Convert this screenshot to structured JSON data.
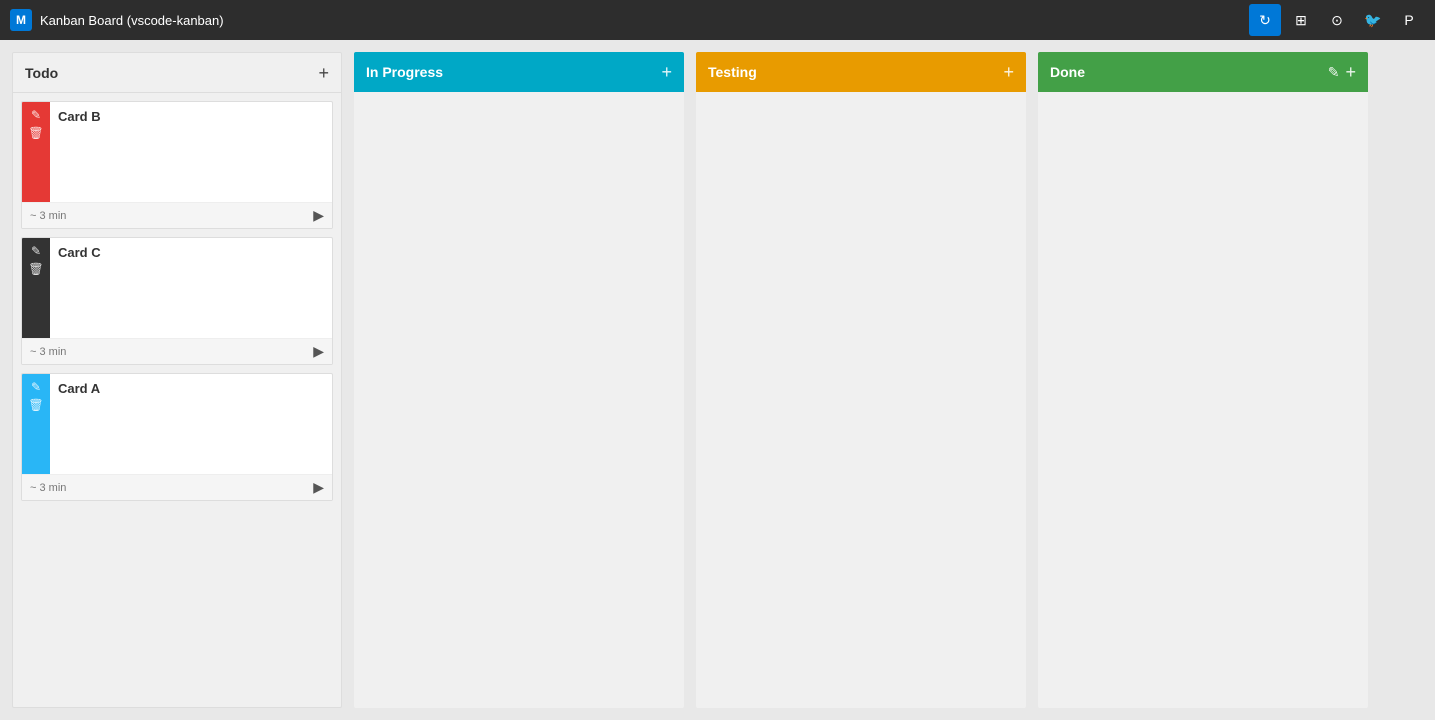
{
  "header": {
    "title": "Kanban Board (vscode-kanban)",
    "logo_text": "M",
    "icons": {
      "refresh": "↻",
      "file": "▦",
      "github": "⊙",
      "twitter": "🐦",
      "patreon": "P"
    }
  },
  "columns": [
    {
      "id": "todo",
      "label": "Todo",
      "color_class": "column-todo",
      "header_color": null,
      "cards": [
        {
          "id": "card-b",
          "title": "Card B",
          "color_class": "card-red",
          "time": "~ 3 min",
          "edit_icon": "✎",
          "delete_icon": "🗑"
        },
        {
          "id": "card-c",
          "title": "Card C",
          "color_class": "card-dark",
          "time": "~ 3 min",
          "edit_icon": "✎",
          "delete_icon": "🗑"
        },
        {
          "id": "card-a",
          "title": "Card A",
          "color_class": "card-blue",
          "time": "~ 3 min",
          "edit_icon": "✎",
          "delete_icon": "🗑"
        }
      ]
    },
    {
      "id": "inprogress",
      "label": "In Progress",
      "color_class": "column-inprogress",
      "cards": []
    },
    {
      "id": "testing",
      "label": "Testing",
      "color_class": "column-testing",
      "cards": []
    },
    {
      "id": "done",
      "label": "Done",
      "color_class": "column-done",
      "cards": [],
      "extra_icon": "✎"
    }
  ],
  "labels": {
    "add": "+",
    "play": "▶"
  }
}
